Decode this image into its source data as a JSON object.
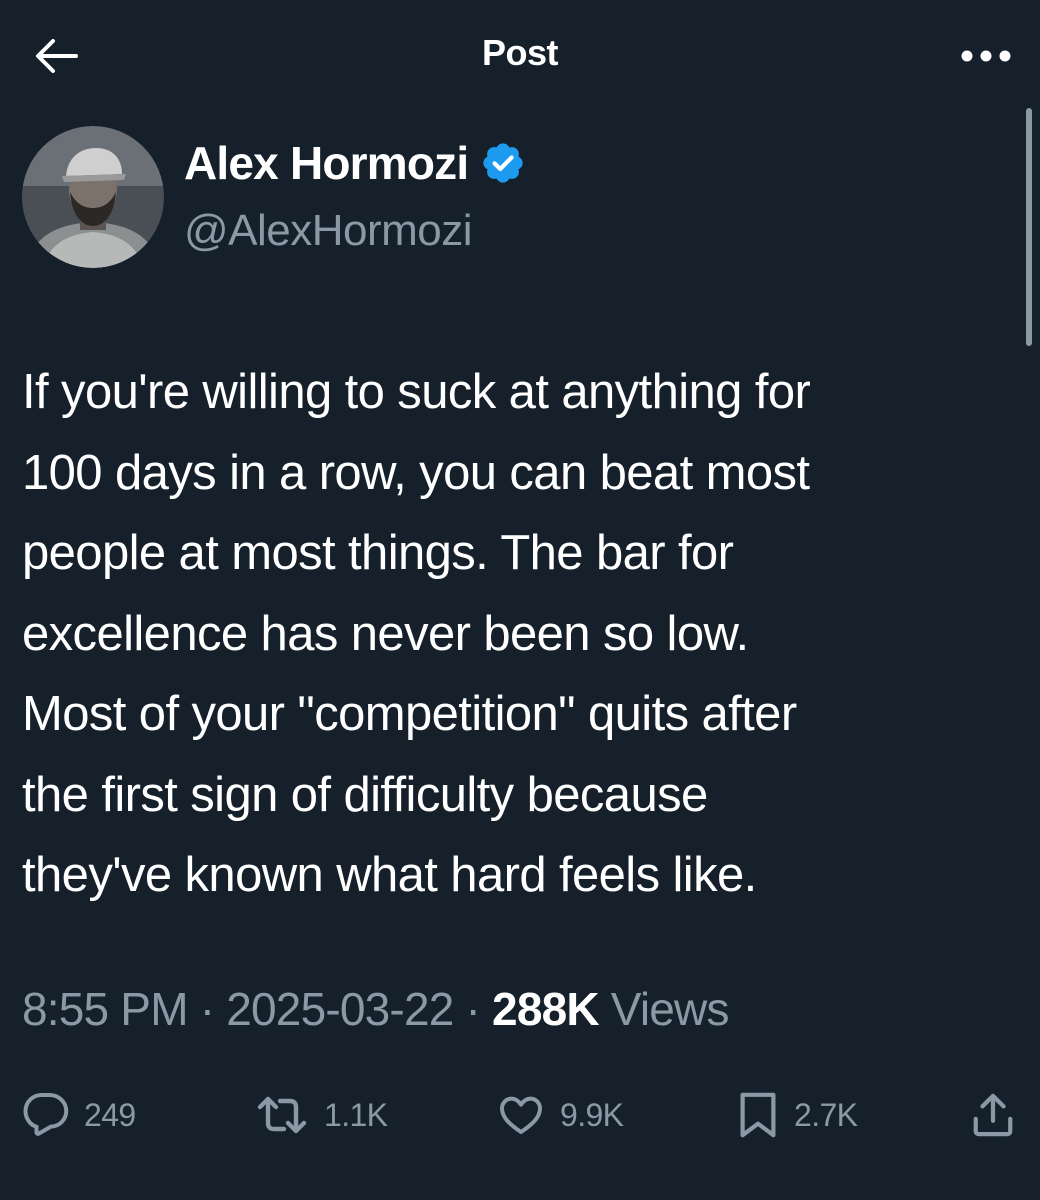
{
  "header": {
    "title": "Post",
    "back_icon": "arrow-left-icon",
    "more_icon": "more-horizontal-icon"
  },
  "author": {
    "name": "Alex Hormozi",
    "handle": "@AlexHormozi",
    "verified_icon": "verified-badge-icon",
    "verified_color": "#1d9bf0"
  },
  "post": {
    "text": "If you're willing to suck at anything for\n100 days in a row, you can beat most\npeople at most things. The bar for\nexcellence has never been so low.\nMost of your \"competition\" quits after\nthe first sign of difficulty because\nthey've known what hard feels like."
  },
  "meta": {
    "time": "8:55 PM",
    "separator": "·",
    "date": "2025-03-22",
    "views_count": "288K",
    "views_label": "Views"
  },
  "actions": {
    "reply": {
      "icon": "reply-icon",
      "count": "249"
    },
    "repost": {
      "icon": "repost-icon",
      "count": "1.1K"
    },
    "like": {
      "icon": "heart-icon",
      "count": "9.9K"
    },
    "bookmark": {
      "icon": "bookmark-icon",
      "count": "2.7K"
    },
    "share": {
      "icon": "share-icon"
    }
  },
  "colors": {
    "background": "#15202b",
    "text_primary": "#ffffff",
    "text_secondary": "#8b98a5",
    "accent": "#1d9bf0"
  }
}
